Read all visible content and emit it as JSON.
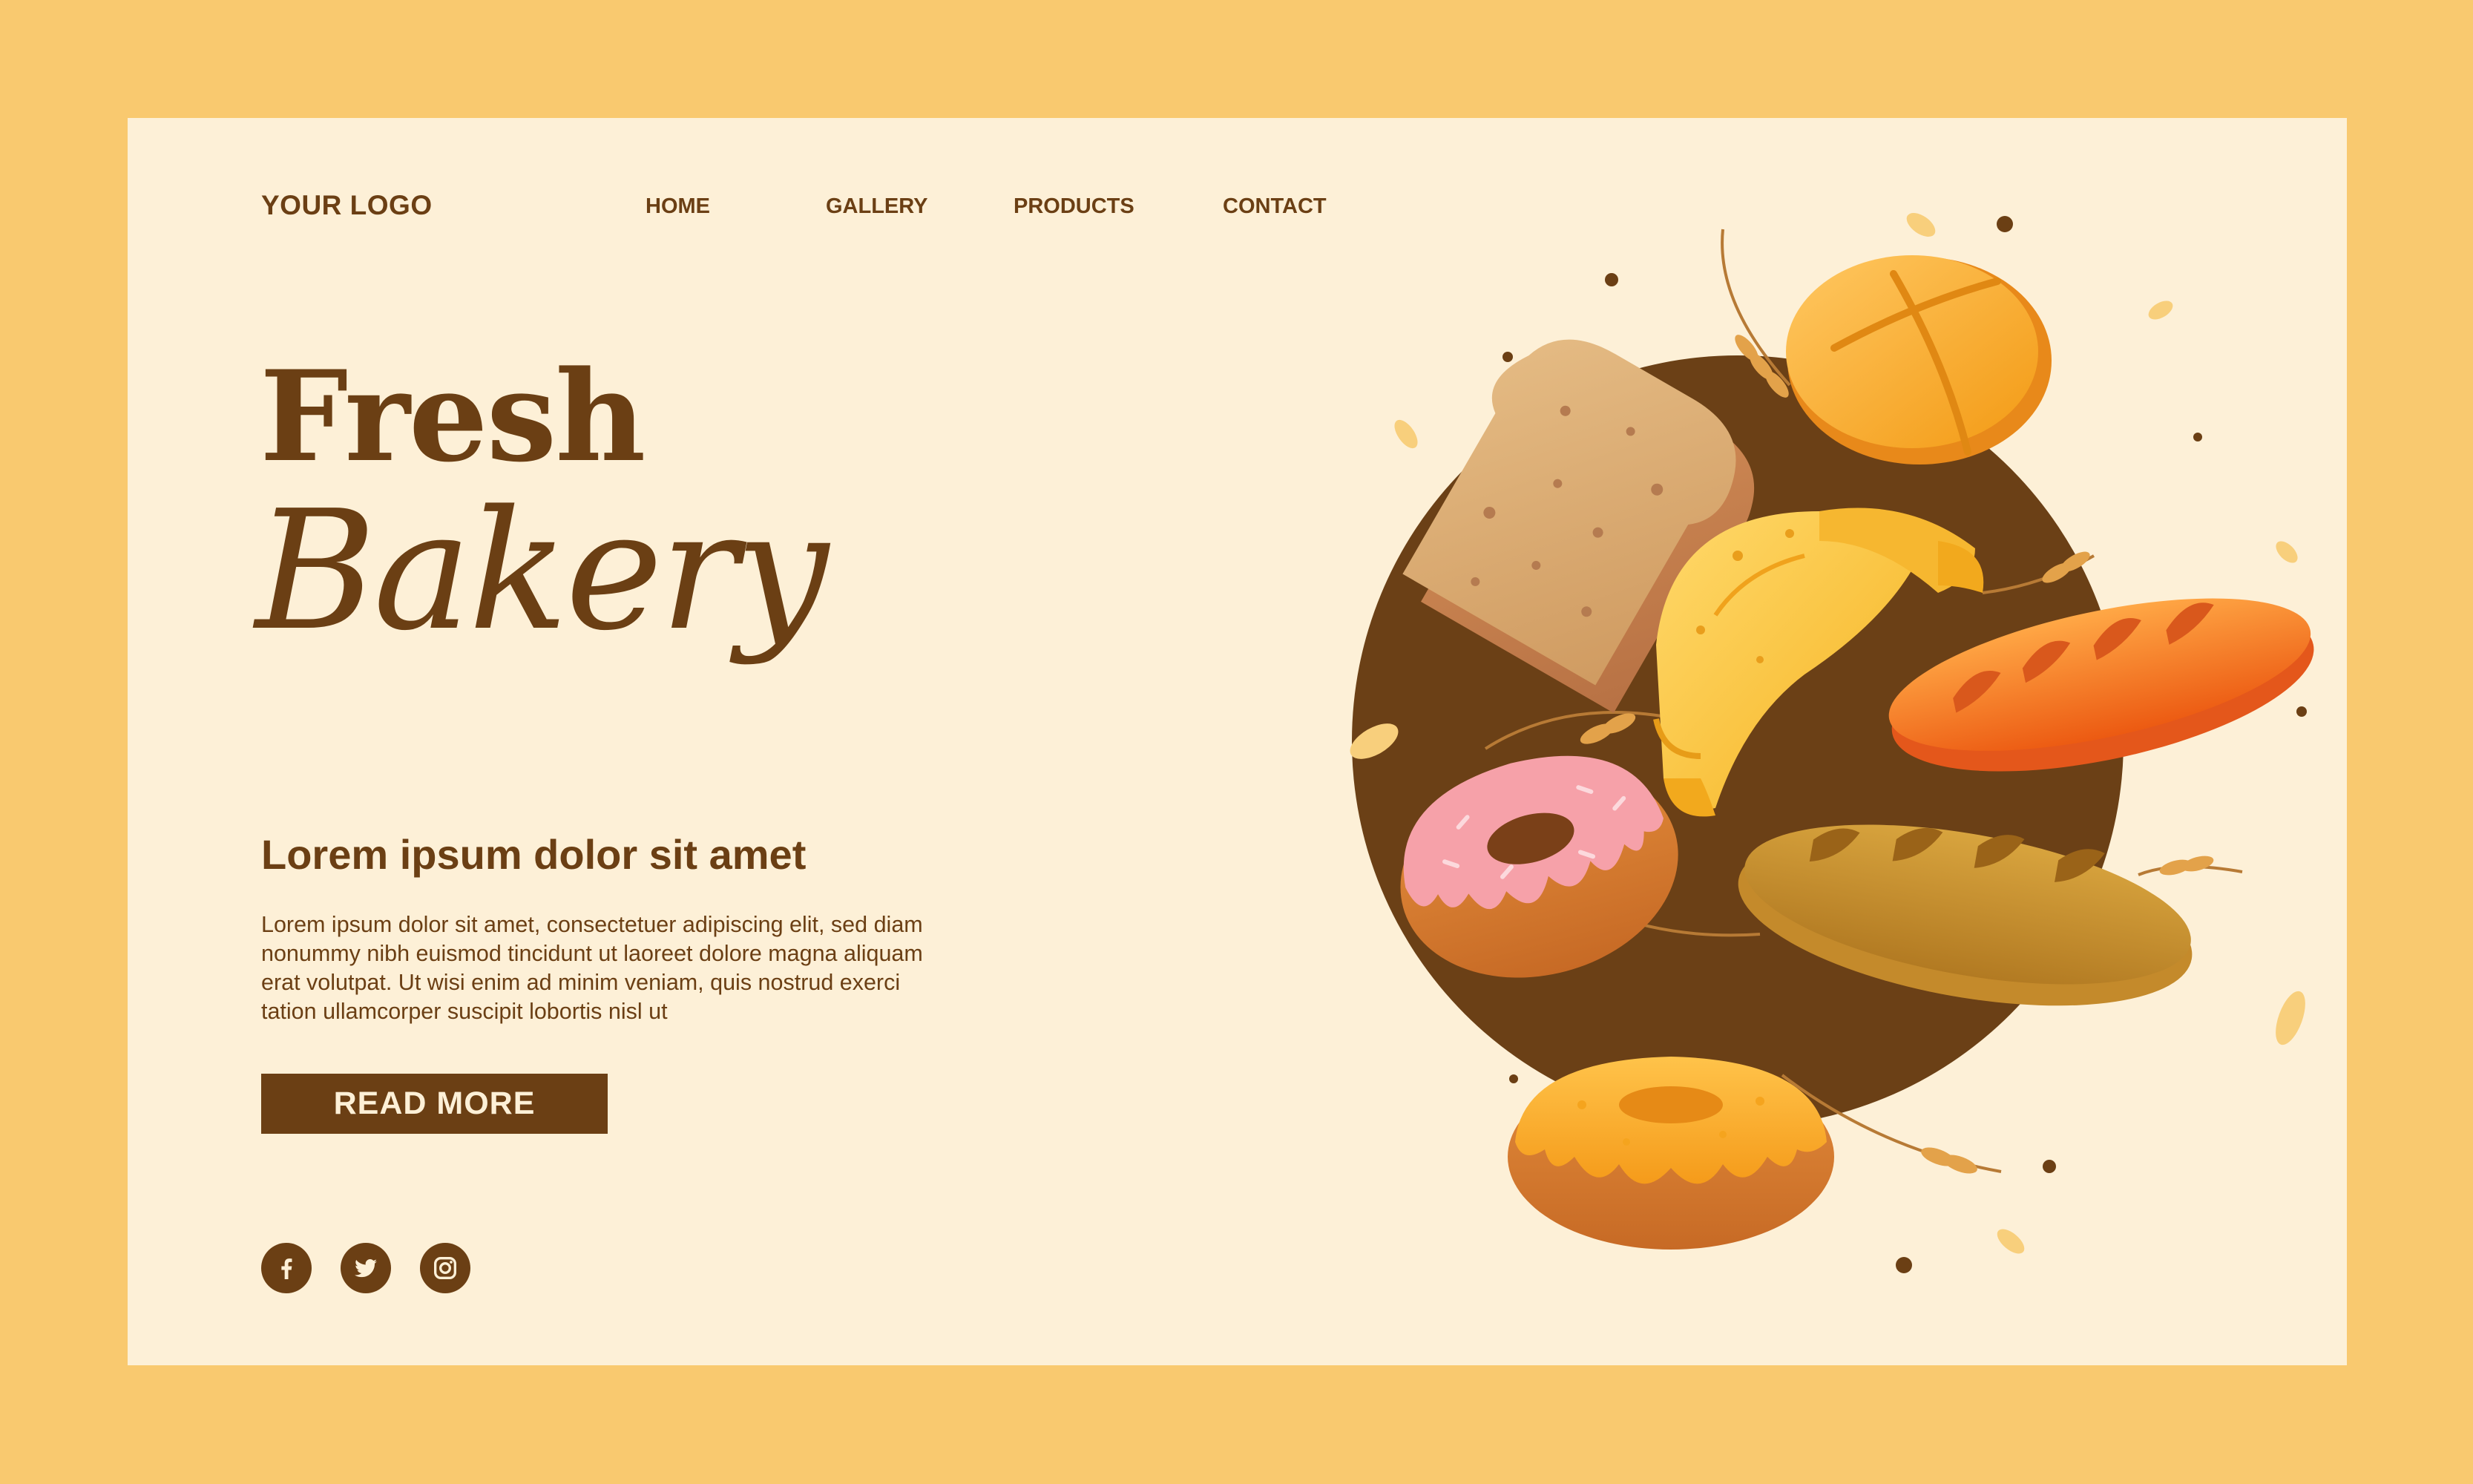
{
  "header": {
    "logo": "YOUR LOGO",
    "nav": [
      "HOME",
      "GALLERY",
      "PRODUCTS",
      "CONTACT"
    ]
  },
  "hero": {
    "title_line1": "Fresh",
    "title_line2": "Bakery",
    "subheading": "Lorem ipsum dolor sit amet",
    "body": "Lorem ipsum dolor sit amet, consectetuer adipiscing elit, sed diam nonummy nibh euismod tincidunt ut laoreet dolore magna aliquam erat volutpat. Ut wisi enim ad minim veniam, quis nostrud exerci tation ullamcorper suscipit lobortis nisl ut",
    "button": "READ MORE"
  },
  "social": [
    "facebook-icon",
    "twitter-icon",
    "instagram-icon"
  ],
  "colors": {
    "frame": "#f9c96f",
    "page": "#fdf0d7",
    "brown": "#6b3f14"
  }
}
